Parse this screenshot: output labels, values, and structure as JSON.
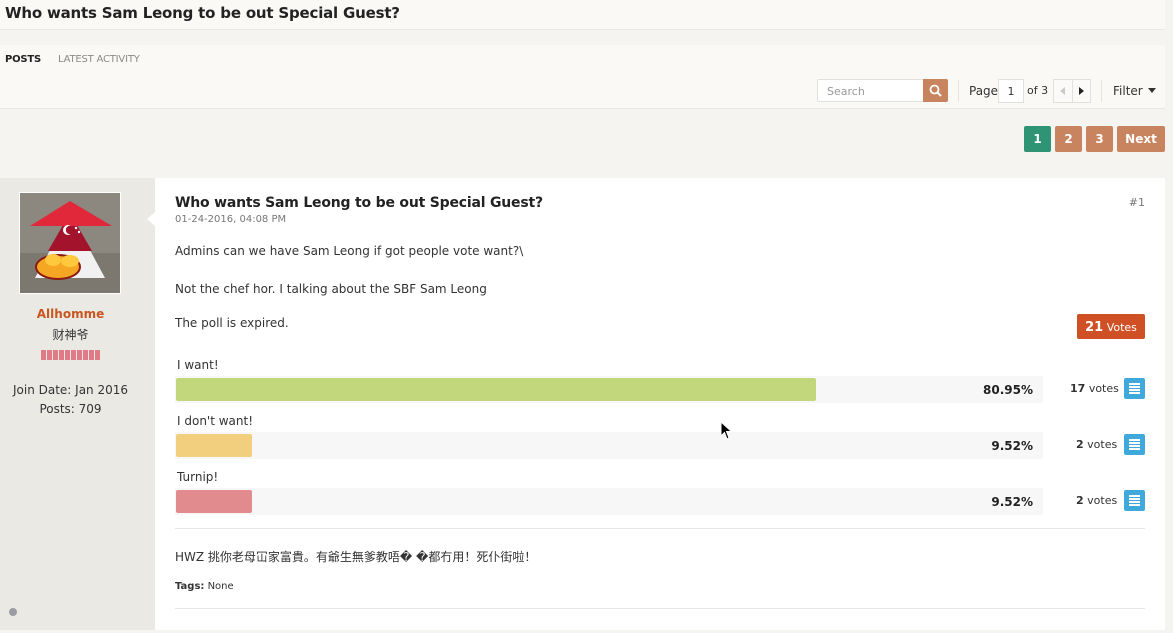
{
  "page": {
    "title": "Who wants Sam Leong to be out Special Guest?"
  },
  "tabs": [
    {
      "label": "POSTS",
      "active": true
    },
    {
      "label": "LATEST ACTIVITY",
      "active": false
    }
  ],
  "toolbar": {
    "search_placeholder": "Search",
    "search_icon": "search-icon",
    "page_label": "Page",
    "current_page": "1",
    "of_total": "of 3",
    "filter_label": "Filter"
  },
  "pagination": {
    "pages": [
      "1",
      "2",
      "3"
    ],
    "active_page": "1",
    "next_label": "Next",
    "colors": {
      "active": "#2e9474",
      "inactive": "#c8845e"
    }
  },
  "post": {
    "number": "#1",
    "title": "Who wants Sam Leong to be out Special Guest?",
    "date": "01-24-2016, 04:08 PM",
    "body": [
      "Admins can we have Sam Leong if got people vote want?\\",
      "Not the chef hor. I talking about the SBF Sam Leong"
    ],
    "signature": "HWZ 挑你老母冚家富貴。有爺生無爹教唔� �都冇用！死仆街啦！",
    "tags_label": "Tags:",
    "tags_value": "None"
  },
  "user": {
    "name": "Allhomme",
    "title": "财神爷",
    "reputation_bars": 10,
    "join_date": "Join Date: Jan 2016",
    "posts": "Posts: 709",
    "name_color": "#c9551f"
  },
  "poll": {
    "status": "The poll is expired.",
    "total_votes": "21",
    "total_votes_label": "Votes",
    "options": [
      {
        "label": "I want!",
        "percent": 80.95,
        "percent_text": "80.95%",
        "votes": "17",
        "votes_label": "votes",
        "color": "#c2d67c"
      },
      {
        "label": "I don't want!",
        "percent": 9.52,
        "percent_text": "9.52%",
        "votes": "2",
        "votes_label": "votes",
        "color": "#f2cf7e"
      },
      {
        "label": "Turnip!",
        "percent": 9.52,
        "percent_text": "9.52%",
        "votes": "2",
        "votes_label": "votes",
        "color": "#e28b8f"
      }
    ]
  }
}
